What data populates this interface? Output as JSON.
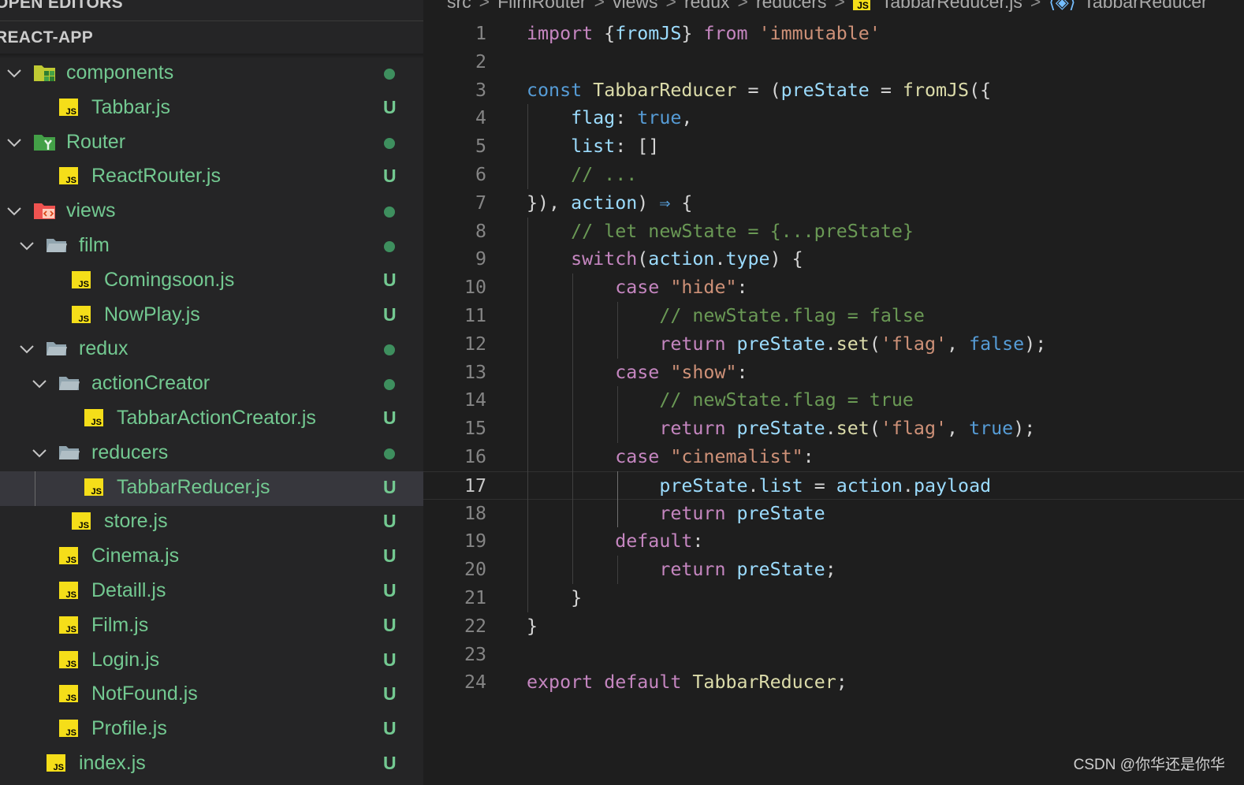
{
  "explorer": {
    "open_editors_label": "OPEN EDITORS",
    "project_label": "REACT-APP",
    "tree": [
      {
        "label": "components",
        "kind": "folder",
        "icon": "components-folder-icon",
        "expanded": true,
        "depth": 0,
        "badge": "dot"
      },
      {
        "label": "Tabbar.js",
        "kind": "file",
        "icon": "js-file-icon",
        "depth": 1,
        "badge": "U"
      },
      {
        "label": "Router",
        "kind": "folder",
        "icon": "router-folder-icon",
        "expanded": true,
        "depth": 0,
        "badge": "dot"
      },
      {
        "label": "ReactRouter.js",
        "kind": "file",
        "icon": "js-file-icon",
        "depth": 1,
        "badge": "U"
      },
      {
        "label": "views",
        "kind": "folder",
        "icon": "views-folder-icon",
        "expanded": true,
        "depth": 0,
        "badge": "dot"
      },
      {
        "label": "film",
        "kind": "folder",
        "icon": "folder-open-icon",
        "expanded": true,
        "depth": 1,
        "badge": "dot"
      },
      {
        "label": "Comingsoon.js",
        "kind": "file",
        "icon": "js-file-icon",
        "depth": 2,
        "badge": "U"
      },
      {
        "label": "NowPlay.js",
        "kind": "file",
        "icon": "js-file-icon",
        "depth": 2,
        "badge": "U"
      },
      {
        "label": "redux",
        "kind": "folder",
        "icon": "folder-open-icon",
        "expanded": true,
        "depth": 1,
        "badge": "dot"
      },
      {
        "label": "actionCreator",
        "kind": "folder",
        "icon": "folder-open-icon",
        "expanded": true,
        "depth": 2,
        "badge": "dot"
      },
      {
        "label": "TabbarActionCreator.js",
        "kind": "file",
        "icon": "js-file-icon",
        "depth": 3,
        "badge": "U"
      },
      {
        "label": "reducers",
        "kind": "folder",
        "icon": "folder-open-icon",
        "expanded": true,
        "depth": 2,
        "badge": "dot"
      },
      {
        "label": "TabbarReducer.js",
        "kind": "file",
        "icon": "js-file-icon",
        "depth": 3,
        "badge": "U",
        "selected": true
      },
      {
        "label": "store.js",
        "kind": "file",
        "icon": "js-file-icon",
        "depth": 2,
        "badge": "U"
      },
      {
        "label": "Cinema.js",
        "kind": "file",
        "icon": "js-file-icon",
        "depth": 1,
        "badge": "U"
      },
      {
        "label": "Detaill.js",
        "kind": "file",
        "icon": "js-file-icon",
        "depth": 1,
        "badge": "U"
      },
      {
        "label": "Film.js",
        "kind": "file",
        "icon": "js-file-icon",
        "depth": 1,
        "badge": "U"
      },
      {
        "label": "Login.js",
        "kind": "file",
        "icon": "js-file-icon",
        "depth": 1,
        "badge": "U"
      },
      {
        "label": "NotFound.js",
        "kind": "file",
        "icon": "js-file-icon",
        "depth": 1,
        "badge": "U"
      },
      {
        "label": "Profile.js",
        "kind": "file",
        "icon": "js-file-icon",
        "depth": 1,
        "badge": "U"
      },
      {
        "label": "index.js",
        "kind": "file",
        "icon": "js-file-icon",
        "depth": 0,
        "badge": "U"
      }
    ]
  },
  "breadcrumb": {
    "items": [
      "src",
      "FilmRouter",
      "views",
      "redux",
      "reducers"
    ],
    "file": "TabbarReducer.js",
    "symbol": "TabbarReducer"
  },
  "editor": {
    "active_line": 17,
    "lines": [
      {
        "n": "1",
        "tokens": [
          [
            "kw",
            "import"
          ],
          [
            "pn",
            " {"
          ],
          [
            "vr",
            "fromJS"
          ],
          [
            "pn",
            "} "
          ],
          [
            "kw",
            "from"
          ],
          [
            "pn",
            " "
          ],
          [
            "st",
            "'immutable'"
          ]
        ]
      },
      {
        "n": "2",
        "tokens": []
      },
      {
        "n": "3",
        "tokens": [
          [
            "kb",
            "const"
          ],
          [
            "pn",
            " "
          ],
          [
            "fn",
            "TabbarReducer"
          ],
          [
            "pn",
            " = ("
          ],
          [
            "vr",
            "preState"
          ],
          [
            "pn",
            " = "
          ],
          [
            "fn",
            "fromJS"
          ],
          [
            "pn",
            "({"
          ]
        ]
      },
      {
        "n": "4",
        "tokens": [
          [
            "pn",
            "    "
          ],
          [
            "vr",
            "flag"
          ],
          [
            "pn",
            ": "
          ],
          [
            "kb",
            "true"
          ],
          [
            "pn",
            ","
          ]
        ]
      },
      {
        "n": "5",
        "tokens": [
          [
            "pn",
            "    "
          ],
          [
            "vr",
            "list"
          ],
          [
            "pn",
            ": []"
          ]
        ]
      },
      {
        "n": "6",
        "tokens": [
          [
            "pn",
            "    "
          ],
          [
            "cm",
            "// ..."
          ]
        ]
      },
      {
        "n": "7",
        "tokens": [
          [
            "pn",
            "}), "
          ],
          [
            "vr",
            "action"
          ],
          [
            "pn",
            ") "
          ],
          [
            "kb",
            "⇒"
          ],
          [
            "pn",
            " {"
          ]
        ]
      },
      {
        "n": "8",
        "tokens": [
          [
            "pn",
            "    "
          ],
          [
            "cm",
            "// let newState = {...preState}"
          ]
        ]
      },
      {
        "n": "9",
        "tokens": [
          [
            "pn",
            "    "
          ],
          [
            "kw",
            "switch"
          ],
          [
            "pn",
            "("
          ],
          [
            "vr",
            "action"
          ],
          [
            "pn",
            "."
          ],
          [
            "vr",
            "type"
          ],
          [
            "pn",
            ") {"
          ]
        ]
      },
      {
        "n": "10",
        "tokens": [
          [
            "pn",
            "        "
          ],
          [
            "kw",
            "case"
          ],
          [
            "pn",
            " "
          ],
          [
            "st",
            "\"hide\""
          ],
          [
            "pn",
            ":"
          ]
        ]
      },
      {
        "n": "11",
        "tokens": [
          [
            "pn",
            "            "
          ],
          [
            "cm",
            "// newState.flag = false"
          ]
        ]
      },
      {
        "n": "12",
        "tokens": [
          [
            "pn",
            "            "
          ],
          [
            "kw",
            "return"
          ],
          [
            "pn",
            " "
          ],
          [
            "vr",
            "preState"
          ],
          [
            "pn",
            "."
          ],
          [
            "fn",
            "set"
          ],
          [
            "pn",
            "("
          ],
          [
            "st",
            "'flag'"
          ],
          [
            "pn",
            ", "
          ],
          [
            "kb",
            "false"
          ],
          [
            "pn",
            ");"
          ]
        ]
      },
      {
        "n": "13",
        "tokens": [
          [
            "pn",
            "        "
          ],
          [
            "kw",
            "case"
          ],
          [
            "pn",
            " "
          ],
          [
            "st",
            "\"show\""
          ],
          [
            "pn",
            ":"
          ]
        ]
      },
      {
        "n": "14",
        "tokens": [
          [
            "pn",
            "            "
          ],
          [
            "cm",
            "// newState.flag = true"
          ]
        ]
      },
      {
        "n": "15",
        "tokens": [
          [
            "pn",
            "            "
          ],
          [
            "kw",
            "return"
          ],
          [
            "pn",
            " "
          ],
          [
            "vr",
            "preState"
          ],
          [
            "pn",
            "."
          ],
          [
            "fn",
            "set"
          ],
          [
            "pn",
            "("
          ],
          [
            "st",
            "'flag'"
          ],
          [
            "pn",
            ", "
          ],
          [
            "kb",
            "true"
          ],
          [
            "pn",
            ");"
          ]
        ]
      },
      {
        "n": "16",
        "tokens": [
          [
            "pn",
            "        "
          ],
          [
            "kw",
            "case"
          ],
          [
            "pn",
            " "
          ],
          [
            "st",
            "\"cinemalist\""
          ],
          [
            "pn",
            ":"
          ]
        ]
      },
      {
        "n": "17",
        "tokens": [
          [
            "pn",
            "            "
          ],
          [
            "vr",
            "preState"
          ],
          [
            "pn",
            "."
          ],
          [
            "vr",
            "list"
          ],
          [
            "pn",
            " = "
          ],
          [
            "vr",
            "action"
          ],
          [
            "pn",
            "."
          ],
          [
            "vr",
            "payload"
          ]
        ]
      },
      {
        "n": "18",
        "tokens": [
          [
            "pn",
            "            "
          ],
          [
            "kw",
            "return"
          ],
          [
            "pn",
            " "
          ],
          [
            "vr",
            "preState"
          ]
        ]
      },
      {
        "n": "19",
        "tokens": [
          [
            "pn",
            "        "
          ],
          [
            "kw",
            "default"
          ],
          [
            "pn",
            ":"
          ]
        ]
      },
      {
        "n": "20",
        "tokens": [
          [
            "pn",
            "            "
          ],
          [
            "kw",
            "return"
          ],
          [
            "pn",
            " "
          ],
          [
            "vr",
            "preState"
          ],
          [
            "pn",
            ";"
          ]
        ]
      },
      {
        "n": "21",
        "tokens": [
          [
            "pn",
            "    }"
          ]
        ]
      },
      {
        "n": "22",
        "tokens": [
          [
            "pn",
            "}"
          ]
        ]
      },
      {
        "n": "23",
        "tokens": []
      },
      {
        "n": "24",
        "tokens": [
          [
            "kw",
            "export"
          ],
          [
            "pn",
            " "
          ],
          [
            "kw",
            "default"
          ],
          [
            "pn",
            " "
          ],
          [
            "fn",
            "TabbarReducer"
          ],
          [
            "pn",
            ";"
          ]
        ]
      }
    ]
  },
  "watermark": "CSDN @你华还是你华",
  "colors": {
    "untracked_green": "#73c991",
    "sidebar_bg": "#252526",
    "editor_bg": "#1e1e1e",
    "selected_row": "#37373d",
    "js_icon_yellow": "#f5de19"
  }
}
